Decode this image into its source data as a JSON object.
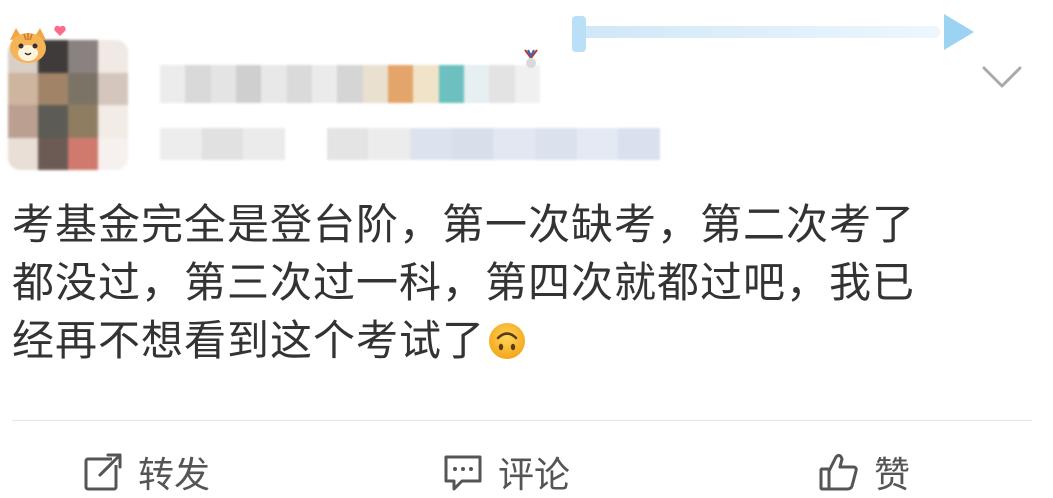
{
  "post": {
    "text_line1": "考基金完全是登台阶，第一次缺考，第二次考了",
    "text_line2": "都没过，第三次过一科，第四次就都过吧，我已",
    "text_line3": "经再不想看到这个考试了",
    "emoji": "upside-down-face-icon"
  },
  "actions": {
    "repost_label": "转发",
    "comment_label": "评论",
    "like_label": "赞"
  },
  "colors": {
    "text": "#333333",
    "action_text": "#555555",
    "divider": "#e6e6e6",
    "background": "#ffffff"
  }
}
